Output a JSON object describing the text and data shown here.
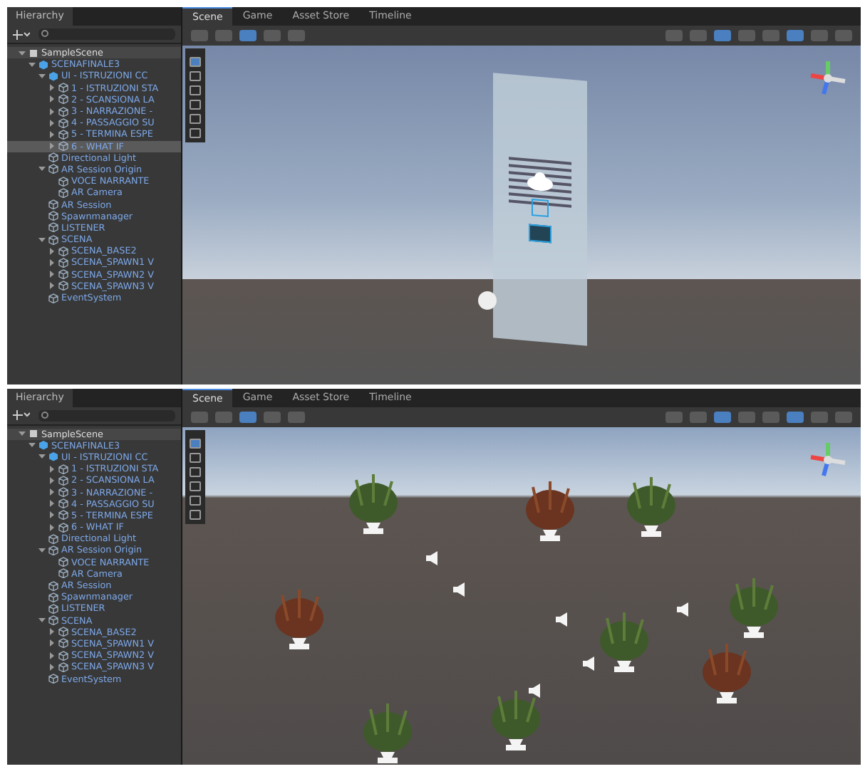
{
  "windows": [
    {
      "hierarchy": {
        "tab": "Hierarchy",
        "tree": [
          {
            "label": "SampleScene",
            "kind": "scene",
            "expanded": true,
            "selected": false,
            "children": [
              {
                "label": "SCENAFINALE3",
                "kind": "prefab",
                "expanded": true,
                "selected": false,
                "children": [
                  {
                    "label": "UI - ISTRUZIONI CC",
                    "kind": "prefab",
                    "expanded": true,
                    "selected": false,
                    "children": [
                      {
                        "label": "1 - ISTRUZIONI STA",
                        "kind": "object",
                        "expanded": false,
                        "selected": false
                      },
                      {
                        "label": "2 - SCANSIONA LA",
                        "kind": "object",
                        "expanded": false,
                        "selected": false
                      },
                      {
                        "label": "3 - NARRAZIONE -",
                        "kind": "object",
                        "expanded": false,
                        "selected": false
                      },
                      {
                        "label": "4 - PASSAGGIO SU",
                        "kind": "object",
                        "expanded": false,
                        "selected": false
                      },
                      {
                        "label": "5 - TERMINA ESPE",
                        "kind": "object",
                        "expanded": false,
                        "selected": false
                      },
                      {
                        "label": "6 - WHAT IF",
                        "kind": "object",
                        "expanded": false,
                        "selected": true
                      }
                    ]
                  },
                  {
                    "label": "Directional Light",
                    "kind": "object",
                    "selected": false
                  },
                  {
                    "label": "AR Session Origin",
                    "kind": "object",
                    "expanded": true,
                    "selected": false,
                    "children": [
                      {
                        "label": "VOCE NARRANTE",
                        "kind": "object",
                        "selected": false
                      },
                      {
                        "label": "AR Camera",
                        "kind": "object",
                        "selected": false
                      }
                    ]
                  },
                  {
                    "label": "AR Session",
                    "kind": "object",
                    "selected": false
                  },
                  {
                    "label": "Spawnmanager",
                    "kind": "object",
                    "selected": false
                  },
                  {
                    "label": "LISTENER",
                    "kind": "object",
                    "selected": false
                  },
                  {
                    "label": "SCENA",
                    "kind": "object",
                    "expanded": true,
                    "selected": false,
                    "children": [
                      {
                        "label": "SCENA_BASE2",
                        "kind": "object",
                        "expanded": false,
                        "selected": false
                      },
                      {
                        "label": "SCENA_SPAWN1 V",
                        "kind": "object",
                        "expanded": false,
                        "selected": false
                      },
                      {
                        "label": "SCENA_SPAWN2 V",
                        "kind": "object",
                        "expanded": false,
                        "selected": false
                      },
                      {
                        "label": "SCENA_SPAWN3 V",
                        "kind": "object",
                        "expanded": false,
                        "selected": false
                      }
                    ]
                  },
                  {
                    "label": "EventSystem",
                    "kind": "object",
                    "selected": false
                  }
                ]
              }
            ]
          }
        ]
      },
      "scene": {
        "tabs": [
          {
            "label": "Scene",
            "selected": true
          },
          {
            "label": "Game",
            "selected": false
          },
          {
            "label": "Asset Store",
            "selected": false
          },
          {
            "label": "Timeline",
            "selected": false
          }
        ],
        "kind": "panel"
      }
    },
    {
      "hierarchy": {
        "tab": "Hierarchy",
        "tree": [
          {
            "label": "SampleScene",
            "kind": "scene",
            "expanded": true,
            "selected": false,
            "children": [
              {
                "label": "SCENAFINALE3",
                "kind": "prefab",
                "expanded": true,
                "selected": false,
                "children": [
                  {
                    "label": "UI - ISTRUZIONI CC",
                    "kind": "prefab",
                    "expanded": true,
                    "selected": false,
                    "children": [
                      {
                        "label": "1 - ISTRUZIONI STA",
                        "kind": "object",
                        "expanded": false,
                        "selected": false
                      },
                      {
                        "label": "2 - SCANSIONA LA",
                        "kind": "object",
                        "expanded": false,
                        "selected": false
                      },
                      {
                        "label": "3 - NARRAZIONE -",
                        "kind": "object",
                        "expanded": false,
                        "selected": false
                      },
                      {
                        "label": "4 - PASSAGGIO SU",
                        "kind": "object",
                        "expanded": false,
                        "selected": false
                      },
                      {
                        "label": "5 - TERMINA ESPE",
                        "kind": "object",
                        "expanded": false,
                        "selected": false
                      },
                      {
                        "label": "6 - WHAT IF",
                        "kind": "object",
                        "expanded": false,
                        "selected": false
                      }
                    ]
                  },
                  {
                    "label": "Directional Light",
                    "kind": "object",
                    "selected": false
                  },
                  {
                    "label": "AR Session Origin",
                    "kind": "object",
                    "expanded": true,
                    "selected": false,
                    "children": [
                      {
                        "label": "VOCE NARRANTE",
                        "kind": "object",
                        "selected": false
                      },
                      {
                        "label": "AR Camera",
                        "kind": "object",
                        "selected": false
                      }
                    ]
                  },
                  {
                    "label": "AR Session",
                    "kind": "object",
                    "selected": false
                  },
                  {
                    "label": "Spawnmanager",
                    "kind": "object",
                    "selected": false
                  },
                  {
                    "label": "LISTENER",
                    "kind": "object",
                    "selected": false
                  },
                  {
                    "label": "SCENA",
                    "kind": "object",
                    "expanded": true,
                    "selected": false,
                    "children": [
                      {
                        "label": "SCENA_BASE2",
                        "kind": "object",
                        "expanded": false,
                        "selected": false
                      },
                      {
                        "label": "SCENA_SPAWN1 V",
                        "kind": "object",
                        "expanded": false,
                        "selected": false
                      },
                      {
                        "label": "SCENA_SPAWN2 V",
                        "kind": "object",
                        "expanded": false,
                        "selected": false
                      },
                      {
                        "label": "SCENA_SPAWN3 V",
                        "kind": "object",
                        "expanded": false,
                        "selected": false
                      }
                    ]
                  },
                  {
                    "label": "EventSystem",
                    "kind": "object",
                    "selected": false
                  }
                ]
              }
            ]
          }
        ]
      },
      "scene": {
        "tabs": [
          {
            "label": "Scene",
            "selected": true
          },
          {
            "label": "Game",
            "selected": false
          },
          {
            "label": "Asset Store",
            "selected": false
          },
          {
            "label": "Timeline",
            "selected": false
          }
        ],
        "kind": "plants"
      }
    }
  ]
}
